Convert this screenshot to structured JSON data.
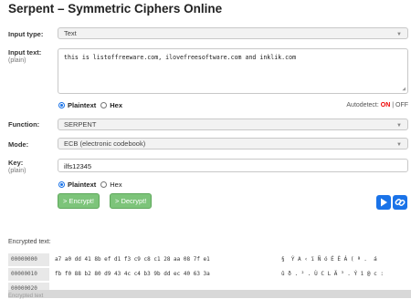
{
  "title": "Serpent – Symmetric Ciphers Online",
  "input_type": {
    "label": "Input type:",
    "value": "Text"
  },
  "input_text": {
    "label": "Input text:",
    "sublabel": "(plain)",
    "value": "this is listoffreeware.com, ilovefreesoftware.com and inklik.com"
  },
  "input_format": {
    "options": [
      "Plaintext",
      "Hex"
    ],
    "selected": "Plaintext",
    "autodetect_label": "Autodetect:",
    "autodetect_on": "ON",
    "separator": "|",
    "autodetect_off": "OFF"
  },
  "function": {
    "label": "Function:",
    "value": "SERPENT"
  },
  "mode": {
    "label": "Mode:",
    "value": "ECB (electronic codebook)"
  },
  "key": {
    "label": "Key:",
    "sublabel": "(plain)",
    "value": "ilfs12345"
  },
  "key_format": {
    "options": [
      "Plaintext",
      "Hex"
    ],
    "selected": "Plaintext"
  },
  "buttons": {
    "encrypt": "> Encrypt!",
    "decrypt": "> Decrypt!"
  },
  "encrypted_label": "Encrypted text:",
  "hex_rows": [
    {
      "offset": "00000000",
      "bytes": "a7 a0 dd 41 8b ef d1 f3 c9 c8 c1 28 aa 08 7f e1",
      "chars": "§  Ý A ‹ ï Ñ ó É È Á ( ª .  á"
    },
    {
      "offset": "00000010",
      "bytes": "fb f0 88 b2 80 d9 43 4c c4 b3 9b dd ec 40 63 3a",
      "chars": "û ð . ² . Ù C L Ä ³ . Ý ì @ c :"
    },
    {
      "offset": "00000020",
      "bytes": "",
      "chars": ""
    }
  ],
  "footer_cutoff": "Encrypted text",
  "colors": {
    "accent": "#1a73e8",
    "button_green": "#7dc47a",
    "on_red": "#ee0000"
  }
}
